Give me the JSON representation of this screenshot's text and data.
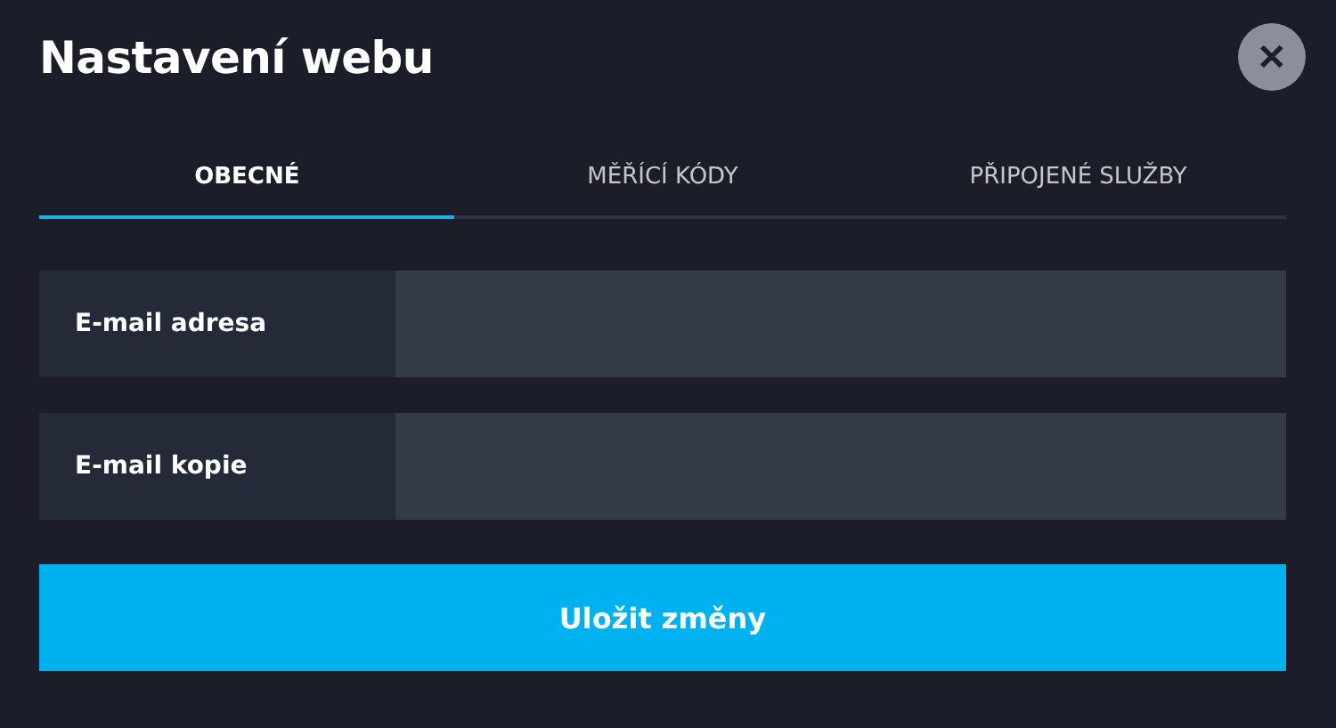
{
  "dialog": {
    "title": "Nastavení webu",
    "close": "✕"
  },
  "tabs": [
    {
      "label": "OBECNÉ",
      "selected": true
    },
    {
      "label": "MĚŘÍCÍ KÓDY",
      "selected": false
    },
    {
      "label": "PŘIPOJENÉ SLUŽBY",
      "selected": false
    }
  ],
  "fields": [
    {
      "label": "E-mail adresa"
    },
    {
      "label": "E-mail kopie"
    }
  ],
  "save_button": "Uložit změny"
}
